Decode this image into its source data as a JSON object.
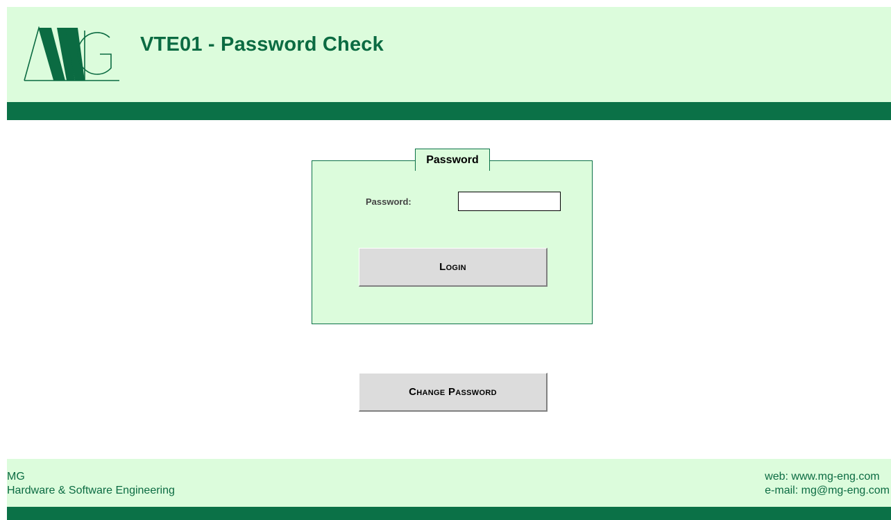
{
  "header": {
    "title": "VTE01 - Password Check",
    "logo_icon": "mg-logo-icon"
  },
  "login_panel": {
    "legend": "Password",
    "password_label": "Password:",
    "password_value": "",
    "login_button": "Login"
  },
  "change_password_button": "Change Password",
  "footer": {
    "company_line1": "MG",
    "company_line2": "Hardware & Software Engineering",
    "web": "web: www.mg-eng.com",
    "email": "e-mail: mg@mg-eng.com"
  },
  "colors": {
    "light_green": "#dcfcdc",
    "dark_green": "#0b7147",
    "title_green": "#0b6b42",
    "button_gray": "#dcdcdc"
  }
}
